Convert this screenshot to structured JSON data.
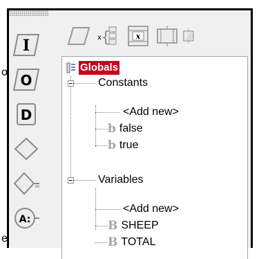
{
  "colors": {
    "panel_bg": "#f0f0f0",
    "selected_bg": "#c8001e",
    "selected_text": "#ffffff",
    "icon_stroke": "#8a8a8a",
    "boolean_marker": "#a6a6a6"
  },
  "palette": {
    "items": [
      {
        "name": "input-statement-icon",
        "glyph": "I"
      },
      {
        "name": "output-statement-icon",
        "glyph": "O"
      },
      {
        "name": "declare-statement-icon",
        "glyph": "D"
      },
      {
        "name": "decision-icon",
        "glyph": ""
      },
      {
        "name": "loop-decision-icon",
        "glyph": ""
      },
      {
        "name": "assign-statement-icon",
        "glyph": "A:"
      }
    ]
  },
  "toolbar": {
    "items": [
      {
        "name": "parallelogram-icon"
      },
      {
        "name": "variable-declare-icon",
        "glyph": "x"
      },
      {
        "name": "assign-x-icon",
        "glyph": "x"
      },
      {
        "name": "call-procedure-icon"
      },
      {
        "name": "hatched-block-icon"
      }
    ]
  },
  "tree": {
    "root": {
      "label": "Globals",
      "icon": "folder-list-icon"
    },
    "groups": [
      {
        "label": "Constants",
        "children": [
          {
            "label": "<Add new>",
            "marker": ""
          },
          {
            "label": "false",
            "marker": "b"
          },
          {
            "label": "true",
            "marker": "b"
          }
        ]
      },
      {
        "label": "Variables",
        "children": [
          {
            "label": "<Add new>",
            "marker": ""
          },
          {
            "label": "SHEEP",
            "marker": "B"
          },
          {
            "label": "TOTAL",
            "marker": "B"
          }
        ]
      }
    ]
  },
  "peek_text": {
    "top": "o",
    "bottom": "e"
  }
}
